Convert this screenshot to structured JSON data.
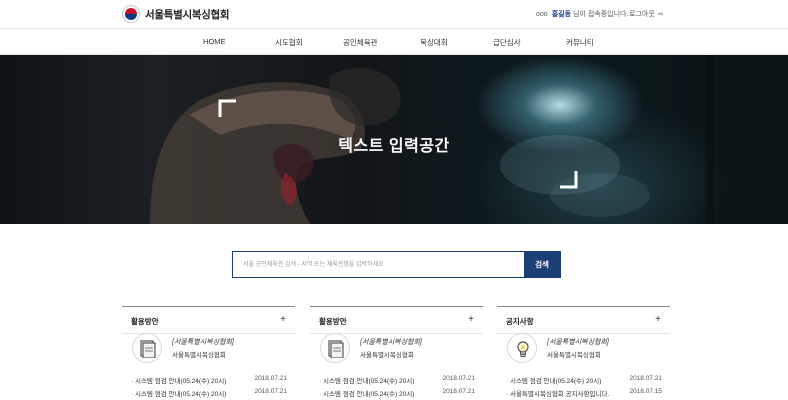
{
  "header": {
    "logo_text": "서울특별시복싱협회",
    "user_prefix": "ooo",
    "user_name": "홍길동",
    "user_suffix": "님이 접속중입니다.",
    "logout_label": "로그아웃",
    "logout_icon": "logout-arrow-icon"
  },
  "nav": {
    "items": [
      {
        "label": "HOME"
      },
      {
        "label": "시도협회"
      },
      {
        "label": "공인체육관"
      },
      {
        "label": "복싱대회"
      },
      {
        "label": "급단심사"
      },
      {
        "label": "커뮤니티"
      }
    ]
  },
  "hero": {
    "title": "텍스트 입력공간"
  },
  "search": {
    "placeholder": "서울 공인체육관 검색 - 지역 또는 체육관명을 입력하세요",
    "button_label": "검색"
  },
  "cards": [
    {
      "title": "활용방안",
      "plus": "+",
      "icon": "document-icon",
      "tag": "[서울특별시복싱협회]",
      "sub": "서울특별시복싱협회",
      "rows": [
        {
          "text": "· 시스템 점검 안내(05.24(수) 20시)",
          "date": "2018.07.21"
        },
        {
          "text": "· 시스템 점검 안내(05.24(수) 20시)",
          "date": "2018.07.21"
        }
      ]
    },
    {
      "title": "활용방안",
      "plus": "+",
      "icon": "document-icon",
      "tag": "[서울특별시복싱협회]",
      "sub": "서울특별시복싱협회",
      "rows": [
        {
          "text": "· 시스템 점검 안내(05.24(수) 20시)",
          "date": "2018.07.21"
        },
        {
          "text": "· 시스템 점검 안내(05.24(수) 20시)",
          "date": "2018.07.21"
        }
      ]
    },
    {
      "title": "공지사항",
      "plus": "+",
      "icon": "lightbulb-icon",
      "tag": "[서울특별시복싱협회]",
      "sub": "서울특별시복싱협회",
      "rows": [
        {
          "text": "· 시스템 점검 안내(05.24(수) 20시)",
          "date": "2018.07.21"
        },
        {
          "text": "· 서울특별시복싱협회 공지사항입니다.",
          "date": "2018.07.15"
        }
      ]
    }
  ],
  "colors": {
    "accent": "#1c3f78",
    "logo_red": "#c8102e",
    "logo_blue": "#0a3a84"
  }
}
